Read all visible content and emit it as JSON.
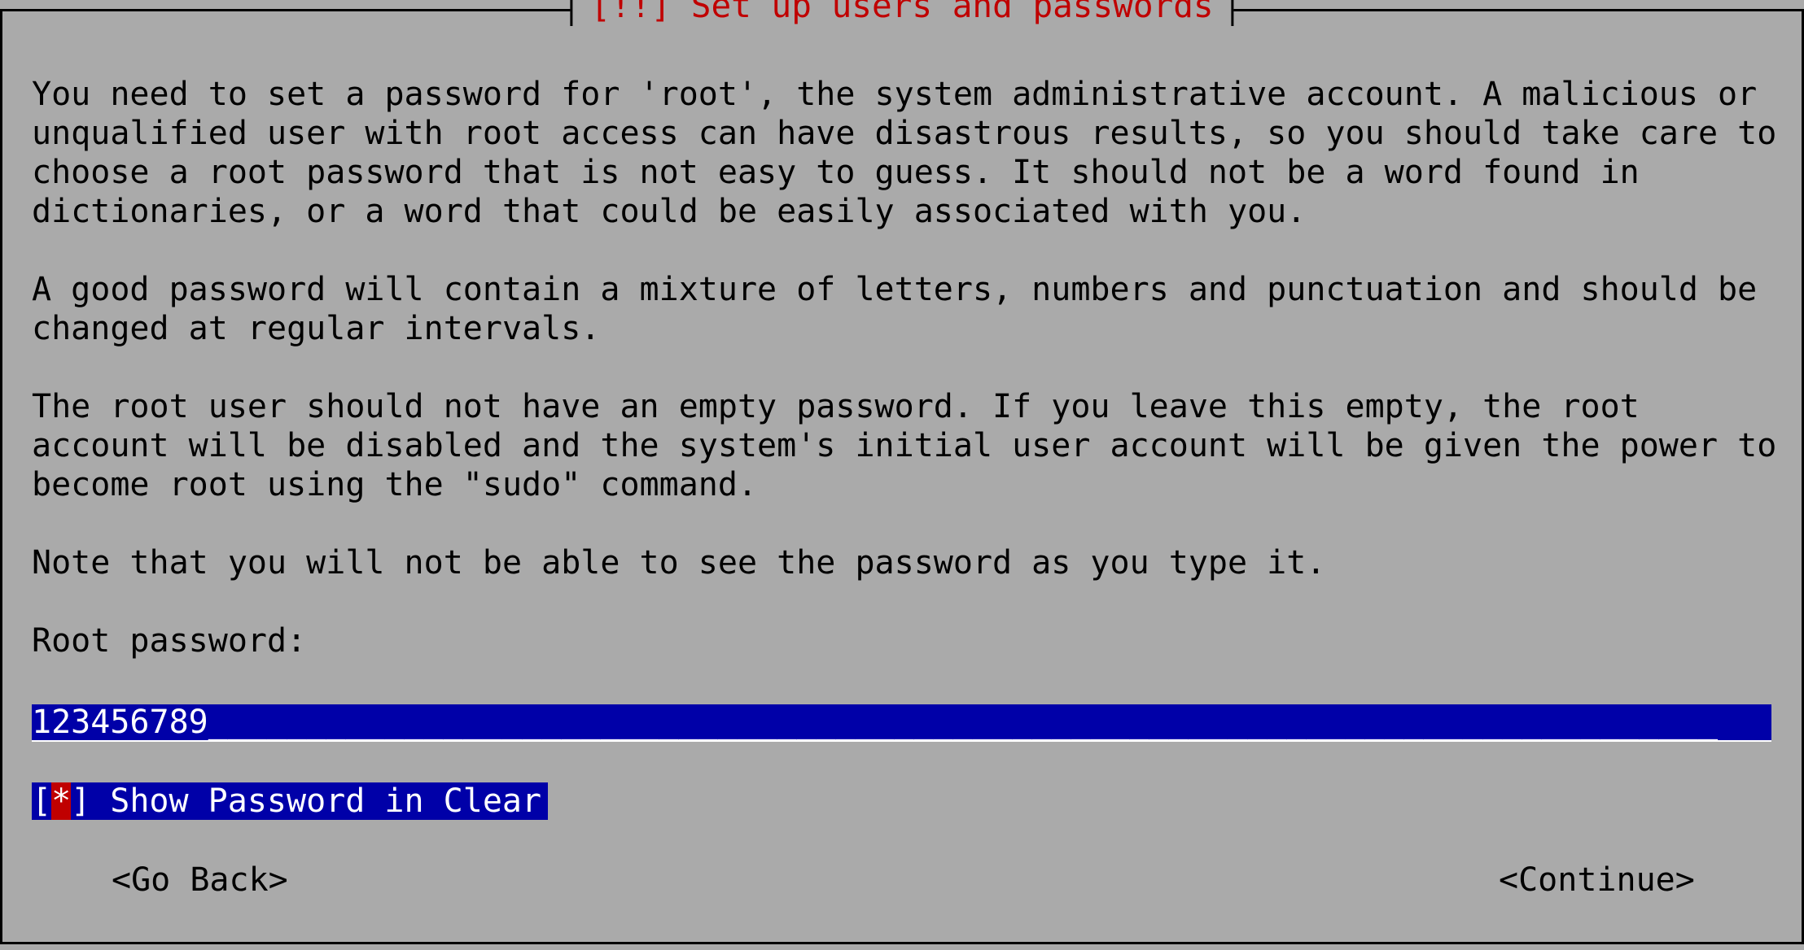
{
  "dialog": {
    "title": "[!!] Set up users and passwords",
    "paragraphs": {
      "p1": "You need to set a password for 'root', the system administrative account. A malicious or\nunqualified user with root access can have disastrous results, so you should take care to\nchoose a root password that is not easy to guess. It should not be a word found in\ndictionaries, or a word that could be easily associated with you.",
      "p2": "A good password will contain a mixture of letters, numbers and punctuation and should be\nchanged at regular intervals.",
      "p3": "The root user should not have an empty password. If you leave this empty, the root\naccount will be disabled and the system's initial user account will be given the power to\nbecome root using the \"sudo\" command.",
      "p4": "Note that you will not be able to see the password as you type it."
    },
    "password_label": "Root password:",
    "password_value": "123456789",
    "password_fill": "_____________________________________________________________________________",
    "show_password": {
      "open_bracket": "[",
      "mark": "*",
      "close_bracket": "]",
      "label": " Show Password in Clear"
    },
    "buttons": {
      "go_back": "<Go Back>",
      "continue": "<Continue>"
    }
  },
  "colors": {
    "background": "#aaaaaa",
    "title_red": "#c00000",
    "field_blue": "#0000a8",
    "text": "#000000"
  }
}
